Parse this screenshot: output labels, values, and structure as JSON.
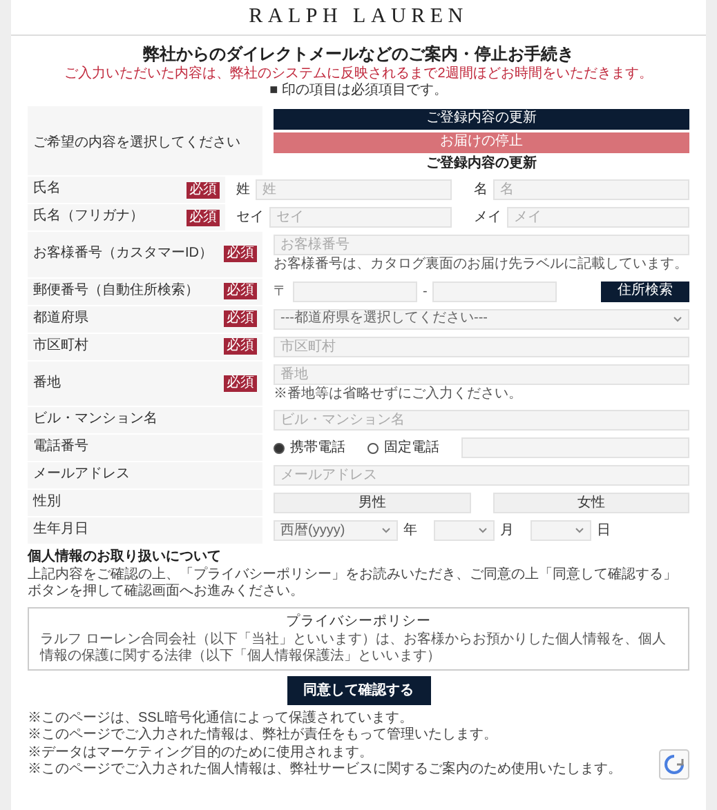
{
  "brand": "RALPH LAUREN",
  "title": "弊社からのダイレクトメールなどのご案内・停止お手続き",
  "notice": "ご入力いただいた内容は、弊社のシステムに反映されるまで2週間ほどお時間をいただきます。",
  "required_note": "■ 印の項目は必須項目です。",
  "request": {
    "label": "ご希望の内容を選択してください",
    "options": [
      {
        "label": "ご登録内容の更新",
        "kind": "dark"
      },
      {
        "label": "お届けの停止",
        "kind": "accent"
      }
    ],
    "heading": "ご登録内容の更新"
  },
  "rows": [
    {
      "label": "氏名",
      "badge": "必須",
      "kind": "pair",
      "fields": [
        {
          "prefix": "姓",
          "placeholder": "姓"
        },
        {
          "prefix": "名",
          "placeholder": "名"
        }
      ]
    },
    {
      "label": "氏名（フリガナ）",
      "badge": "必須",
      "kind": "pair",
      "fields": [
        {
          "prefix": "セイ",
          "placeholder": "セイ"
        },
        {
          "prefix": "メイ",
          "placeholder": "メイ"
        }
      ]
    },
    {
      "label": "お客様番号（カスタマーID）",
      "badge": "必須",
      "kind": "text",
      "placeholder": "お客様番号",
      "hint": "お客様番号は、カタログ裏面のお届け先ラベルに記載しています。"
    },
    {
      "label": "郵便番号（自動住所検索）",
      "badge": "必須",
      "kind": "postal",
      "prefix": "〒",
      "separator": "-",
      "button": "住所検索"
    },
    {
      "label": "都道府県",
      "badge": "必須",
      "kind": "select",
      "value": "---都道府県を選択してください---"
    },
    {
      "label": "市区町村",
      "badge": "必須",
      "kind": "text",
      "placeholder": "市区町村"
    },
    {
      "label": "番地",
      "badge": "必須",
      "kind": "text",
      "placeholder": "番地",
      "hint": "※番地等は省略せずにご入力ください。"
    },
    {
      "label": "ビル・マンション名",
      "kind": "text",
      "placeholder": "ビル・マンション名"
    },
    {
      "label": "電話番号",
      "kind": "radio",
      "options": [
        {
          "label": "携帯電話",
          "selected": true
        },
        {
          "label": "固定電話",
          "selected": false
        }
      ]
    },
    {
      "label": "メールアドレス",
      "kind": "text",
      "placeholder": "メールアドレス"
    },
    {
      "label": "性別",
      "kind": "buttons",
      "options": [
        {
          "label": "男性",
          "selected": false
        },
        {
          "label": "女性",
          "selected": false
        }
      ]
    },
    {
      "label": "生年月日",
      "kind": "date",
      "parts": [
        {
          "value": "西暦(yyyy)",
          "unit": "年"
        },
        {
          "unit": "月"
        },
        {
          "unit": "日"
        }
      ]
    }
  ],
  "privacy": {
    "heading": "個人情報のお取り扱いについて",
    "text": "上記内容をご確認の上、「プライバシーポリシー」をお読みいただき、ご同意の上「同意して確認する」ボタンを押して確認画面へお進みください。",
    "box_title": "プライバシーポリシー",
    "box_text": "ラルフ ローレン合同会社（以下「当社」といいます）は、お客様からお預かりした個人情報を、個人情報の保護に関する法律（以下「個人情報保護法」といいます）"
  },
  "submit": "同意して確認する",
  "notes": [
    "※このページは、SSL暗号化通信によって保護されています。",
    "※このページでご入力された情報は、弊社が責任をもって管理いたします。",
    "※データはマーケティング目的のために使用されます。",
    "※このページでご入力された個人情報は、弊社サービスに関するご案内のため使用いたします。"
  ]
}
